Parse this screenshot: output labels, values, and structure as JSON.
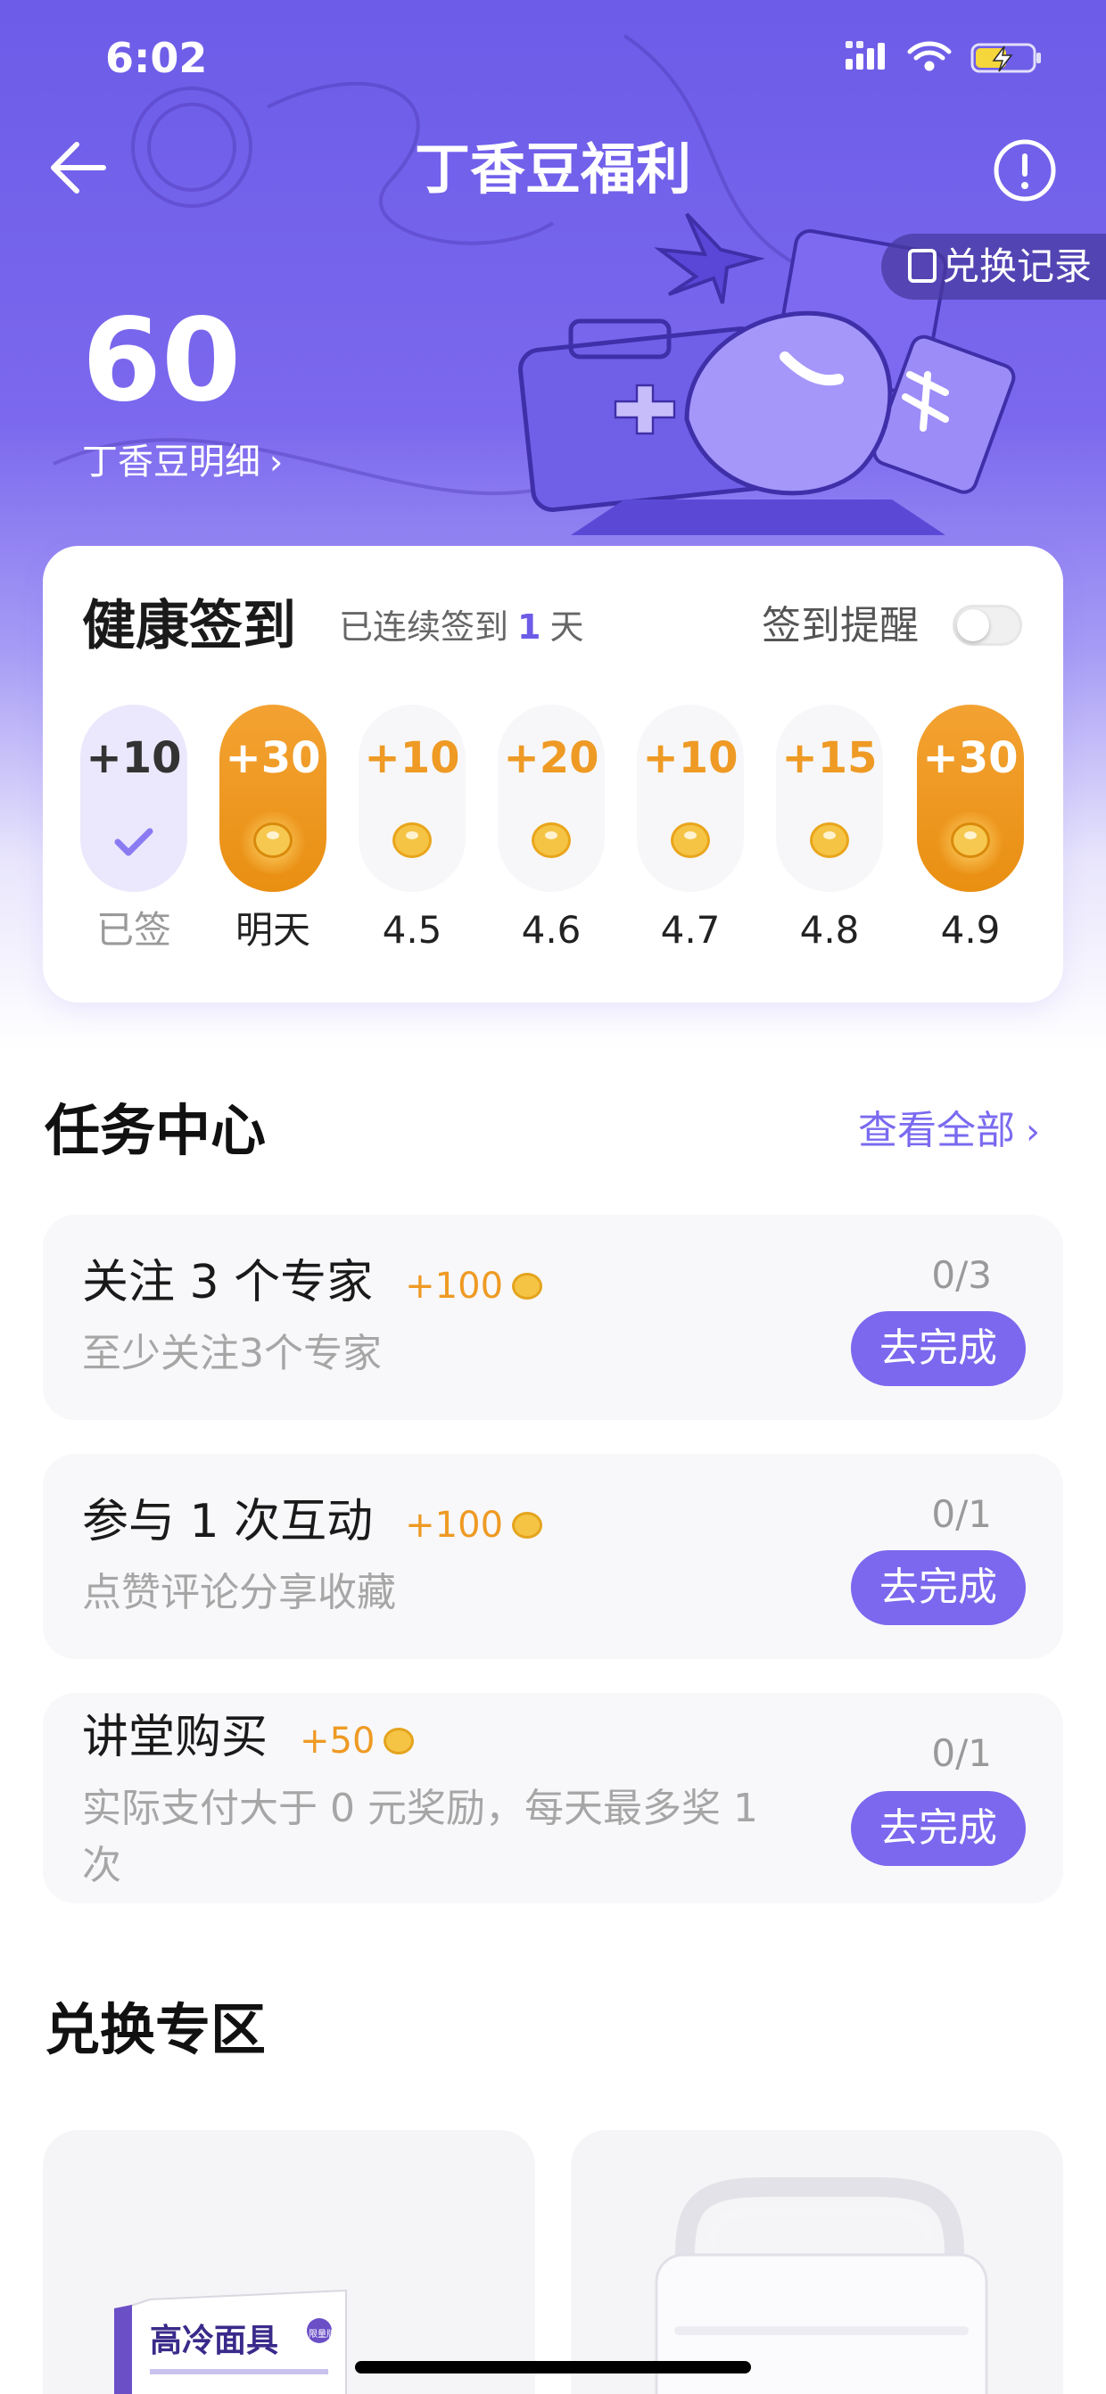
{
  "status_bar": {
    "time": "6:02"
  },
  "nav": {
    "title": "丁香豆福利"
  },
  "exchange_records": {
    "label": "兑换记录"
  },
  "points": {
    "value": "60",
    "detail_link": "丁香豆明细"
  },
  "checkin": {
    "title": "健康签到",
    "streak_prefix": "已连续签到",
    "streak_days": "1",
    "streak_suffix": "天",
    "reminder_label": "签到提醒",
    "reminder_on": false,
    "days": [
      {
        "points": "+10",
        "label": "已签",
        "state": "done"
      },
      {
        "points": "+30",
        "label": "明天",
        "state": "big"
      },
      {
        "points": "+10",
        "label": "4.5",
        "state": "normal"
      },
      {
        "points": "+20",
        "label": "4.6",
        "state": "normal"
      },
      {
        "points": "+10",
        "label": "4.7",
        "state": "normal"
      },
      {
        "points": "+15",
        "label": "4.8",
        "state": "normal"
      },
      {
        "points": "+30",
        "label": "4.9",
        "state": "big"
      }
    ]
  },
  "task_center": {
    "title": "任务中心",
    "view_all": "查看全部",
    "tasks": [
      {
        "title": "关注 3 个专家",
        "reward": "+100",
        "desc": "至少关注3个专家",
        "progress": "0/3",
        "button": "去完成"
      },
      {
        "title": "参与 1 次互动",
        "reward": "+100",
        "desc": "点赞评论分享收藏",
        "progress": "0/1",
        "button": "去完成"
      },
      {
        "title": "讲堂购买",
        "reward": "+50",
        "desc_line1": "实际支付大于 0 元奖励，每天最多奖 1",
        "desc_line2": "次",
        "progress": "0/1",
        "button": "去完成"
      }
    ]
  },
  "exchange_zone": {
    "title": "兑换专区",
    "products": [
      {
        "name": "高冷面具",
        "tag": "限量版"
      },
      {
        "name": ""
      }
    ]
  },
  "colors": {
    "accent": "#7b68ee",
    "reward": "#ee9a24",
    "hero": "#6c5ce7"
  }
}
